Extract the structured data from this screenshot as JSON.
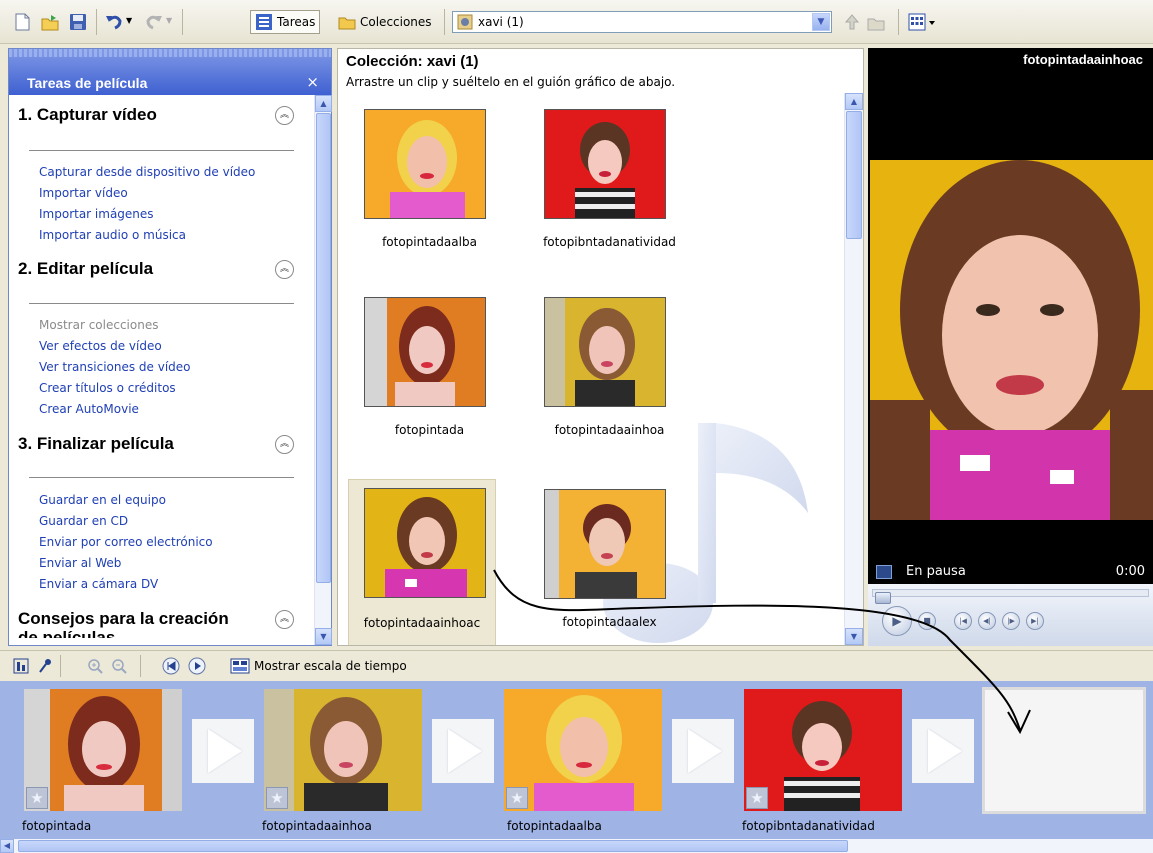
{
  "toolbar": {
    "tasks_label": "Tareas",
    "collections_label": "Colecciones",
    "collection_selected": "xavi (1)"
  },
  "task_pane": {
    "title": "Tareas de película",
    "close": "×",
    "sections": [
      {
        "title": "1. Capturar vídeo",
        "links": [
          "Capturar desde dispositivo de vídeo",
          "Importar vídeo",
          "Importar imágenes",
          "Importar audio o música"
        ]
      },
      {
        "title": "2. Editar película",
        "links": [
          "Mostrar colecciones",
          "Ver efectos de vídeo",
          "Ver transiciones de vídeo",
          "Crear títulos o créditos",
          "Crear AutoMovie"
        ]
      },
      {
        "title": "3. Finalizar película",
        "links": [
          "Guardar en el equipo",
          "Guardar en CD",
          "Enviar por correo electrónico",
          "Enviar al Web",
          "Enviar a cámara DV"
        ]
      },
      {
        "title_line1": "Consejos para la creación",
        "title_line2": "de películas"
      }
    ]
  },
  "collection": {
    "title": "Colección: xavi (1)",
    "hint": "Arrastre un clip y suéltelo en el guión gráfico de abajo.",
    "clips": [
      "fotopintadaalba",
      "fotopibntadanatividad",
      "fotopintada",
      "fotopintadaainhoa",
      "fotopintadaainhoac",
      "fotopintadaalex"
    ]
  },
  "monitor": {
    "title": "fotopintadaainhoac",
    "status": "En pausa",
    "time": "0:00"
  },
  "storyboard_toolbar": {
    "timeline_label": "Mostrar escala de tiempo"
  },
  "storyboard": {
    "frames": [
      "fotopintada",
      "fotopintadaainhoa",
      "fotopintadaalba",
      "fotopibntadanatividad"
    ]
  },
  "colors": {
    "pane_header": "#3f60d1",
    "link": "#1f3fb4",
    "storyboard_bg": "#9fb3e5"
  }
}
